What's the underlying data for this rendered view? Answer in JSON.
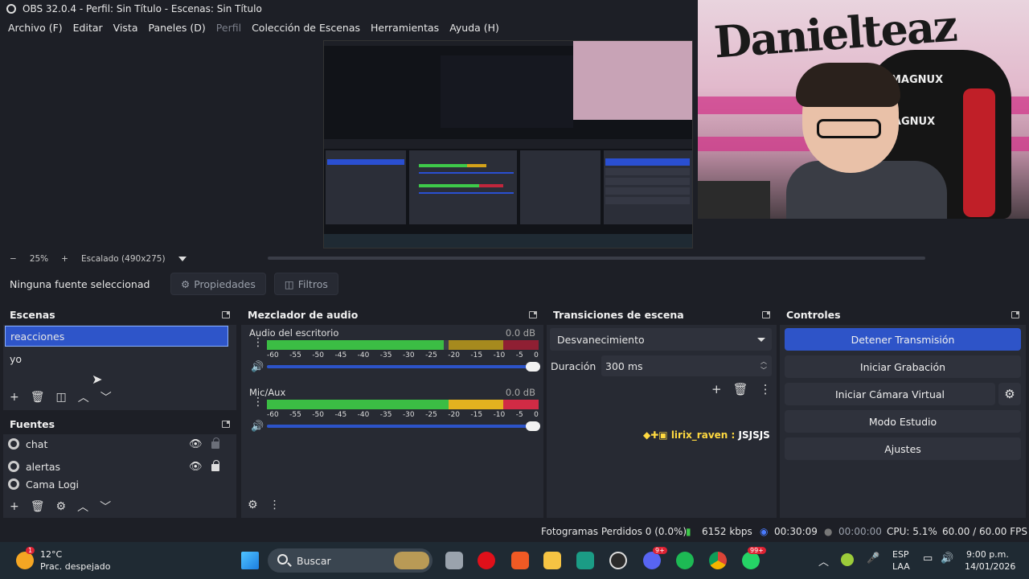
{
  "window": {
    "title": "OBS 32.0.4 - Perfil: Sin Título - Escenas: Sin Título"
  },
  "menu": {
    "items": [
      {
        "label": "Archivo (F)",
        "enabled": true
      },
      {
        "label": "Editar",
        "enabled": true
      },
      {
        "label": "Vista",
        "enabled": true
      },
      {
        "label": "Paneles (D)",
        "enabled": true
      },
      {
        "label": "Perfil",
        "enabled": false
      },
      {
        "label": "Colección de Escenas",
        "enabled": true
      },
      {
        "label": "Herramientas",
        "enabled": true
      },
      {
        "label": "Ayuda (H)",
        "enabled": true
      }
    ]
  },
  "webcam": {
    "wall_text": "Danielteaz",
    "chair_brand_top": "MAGNUX",
    "chair_brand_mid": "MAGNUX"
  },
  "zoombar": {
    "minus": "−",
    "zoom": "25%",
    "plus": "+",
    "scaling": "Escalado (490x275)"
  },
  "context": {
    "no_source": "Ninguna fuente seleccionad",
    "properties": "Propiedades",
    "filters": "Filtros"
  },
  "scenes": {
    "title": "Escenas",
    "items": [
      {
        "label": "reacciones",
        "selected": true
      },
      {
        "label": "yo",
        "selected": false
      }
    ]
  },
  "sources": {
    "title": "Fuentes",
    "items": [
      {
        "label": "chat",
        "visible": true,
        "locked": false
      },
      {
        "label": "alertas",
        "visible": true,
        "locked": true
      },
      {
        "label": "Cama Logi",
        "visible": true,
        "locked": false
      }
    ]
  },
  "mixer": {
    "title": "Mezclador de audio",
    "scale": [
      "-60",
      "-55",
      "-50",
      "-45",
      "-40",
      "-35",
      "-30",
      "-25",
      "-20",
      "-15",
      "-10",
      "-5",
      "0"
    ],
    "channels": [
      {
        "name": "Audio del escritorio",
        "db": "0.0 dB",
        "level": 0.65,
        "volume": 1.0
      },
      {
        "name": "Mic/Aux",
        "db": "0.0 dB",
        "level": 0.99,
        "volume": 1.0
      }
    ]
  },
  "transitions": {
    "title": "Transiciones de escena",
    "selected": "Desvanecimiento",
    "duration_label": "Duración",
    "duration_value": "300 ms"
  },
  "chat_overlay": {
    "user": "lirix_raven :",
    "message": "JSJSJS"
  },
  "controls": {
    "title": "Controles",
    "buttons": [
      {
        "label": "Detener Transmisión",
        "active": true
      },
      {
        "label": "Iniciar Grabación",
        "active": false
      },
      {
        "label": "Iniciar Cámara Virtual",
        "active": false
      },
      {
        "label": "Modo Estudio",
        "active": false
      },
      {
        "label": "Ajustes",
        "active": false
      }
    ]
  },
  "status": {
    "dropped": "Fotogramas Perdidos 0 (0.0%)",
    "bitrate": "6152 kbps",
    "stream_time": "00:30:09",
    "rec_time": "00:00:00",
    "cpu": "CPU: 5.1%",
    "fps": "60.00 / 60.00 FPS"
  },
  "taskbar": {
    "weather_badge": "1",
    "temp": "12°C",
    "weather_desc": "Prac. despejado",
    "search": "Buscar",
    "discord_badge": "9+",
    "whatsapp_badge": "99+",
    "lang_top": "ESP",
    "lang_bottom": "LAA",
    "time": "9:00 p.m.",
    "date": "14/01/2026"
  },
  "colors": {
    "accent": "#2e55c9",
    "meter_green": "#3bbd44",
    "meter_yellow": "#e3b21f",
    "meter_red": "#d12b45",
    "panel": "#272a33",
    "background": "#1d1f26"
  }
}
